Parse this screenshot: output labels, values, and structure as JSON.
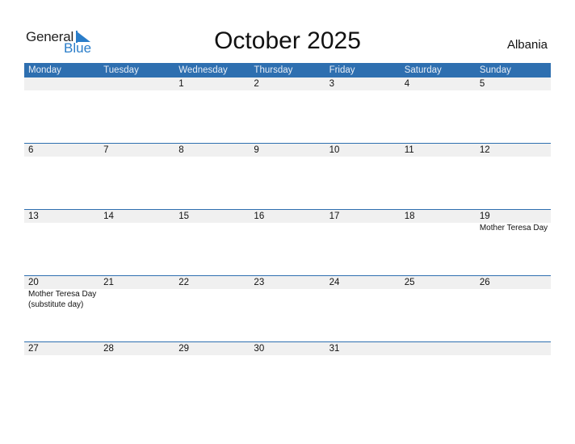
{
  "logo": {
    "word1": "General",
    "word2": "Blue"
  },
  "title": "October 2025",
  "country": "Albania",
  "colors": {
    "header_bg": "#2e6fb0",
    "accent": "#2a7dc9",
    "date_row_bg": "#f0f0f0"
  },
  "weekdays": [
    "Monday",
    "Tuesday",
    "Wednesday",
    "Thursday",
    "Friday",
    "Saturday",
    "Sunday"
  ],
  "weeks": [
    {
      "days": [
        "",
        "",
        "1",
        "2",
        "3",
        "4",
        "5"
      ],
      "events": [
        "",
        "",
        "",
        "",
        "",
        "",
        ""
      ]
    },
    {
      "days": [
        "6",
        "7",
        "8",
        "9",
        "10",
        "11",
        "12"
      ],
      "events": [
        "",
        "",
        "",
        "",
        "",
        "",
        ""
      ]
    },
    {
      "days": [
        "13",
        "14",
        "15",
        "16",
        "17",
        "18",
        "19"
      ],
      "events": [
        "",
        "",
        "",
        "",
        "",
        "",
        "Mother Teresa Day"
      ]
    },
    {
      "days": [
        "20",
        "21",
        "22",
        "23",
        "24",
        "25",
        "26"
      ],
      "events": [
        "Mother Teresa Day (substitute day)",
        "",
        "",
        "",
        "",
        "",
        ""
      ]
    },
    {
      "days": [
        "27",
        "28",
        "29",
        "30",
        "31",
        "",
        ""
      ],
      "events": [
        "",
        "",
        "",
        "",
        "",
        "",
        ""
      ]
    }
  ]
}
